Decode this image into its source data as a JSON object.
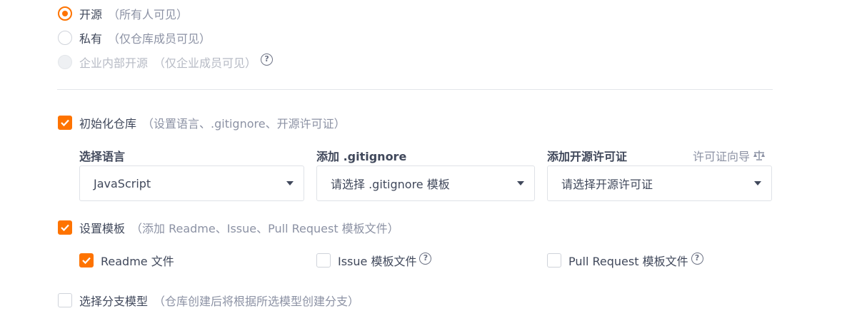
{
  "visibility": {
    "options": [
      {
        "label": "开源",
        "hint": "（所有人可见）",
        "checked": true,
        "disabled": false
      },
      {
        "label": "私有",
        "hint": "（仅仓库成员可见）",
        "checked": false,
        "disabled": false
      },
      {
        "label": "企业内部开源",
        "hint": "（仅企业成员可见）",
        "checked": false,
        "disabled": true
      }
    ]
  },
  "init_repo": {
    "label": "初始化仓库",
    "hint": "（设置语言、.gitignore、开源许可证）",
    "checked": true,
    "language": {
      "title": "选择语言",
      "value": "JavaScript"
    },
    "gitignore": {
      "title": "添加 .gitignore",
      "value": "请选择 .gitignore 模板"
    },
    "license": {
      "title": "添加开源许可证",
      "value": "请选择开源许可证",
      "wizard_label": "许可证向导"
    }
  },
  "templates": {
    "label": "设置模板",
    "hint": "（添加 Readme、Issue、Pull Request 模板文件）",
    "checked": true,
    "items": [
      {
        "label": "Readme 文件",
        "checked": true
      },
      {
        "label": "Issue 模板文件",
        "checked": false
      },
      {
        "label": "Pull Request 模板文件",
        "checked": false
      }
    ]
  },
  "branch_model": {
    "label": "选择分支模型",
    "hint": "（仓库创建后将根据所选模型创建分支）",
    "checked": false
  },
  "colors": {
    "accent": "#fe7300"
  }
}
